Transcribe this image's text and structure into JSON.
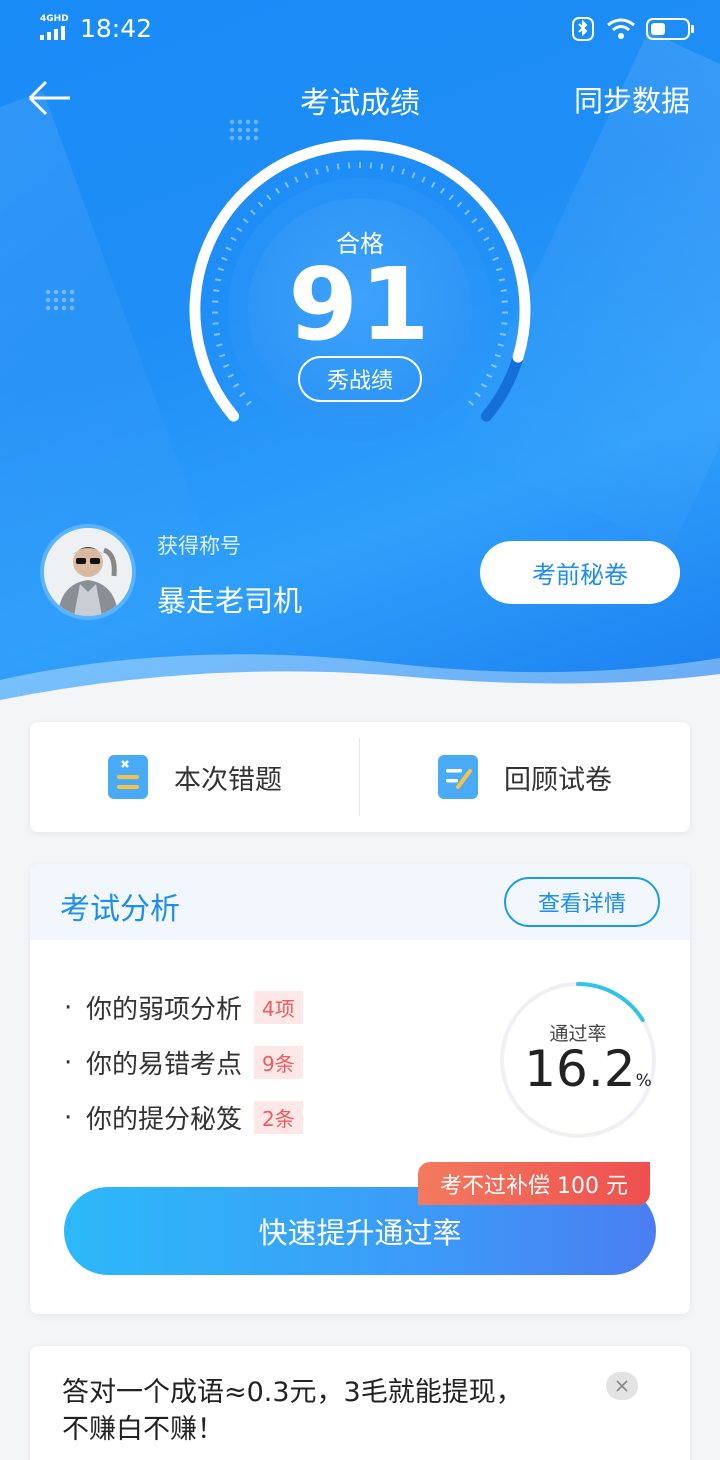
{
  "status": {
    "network": "4GHD",
    "time": "18:42"
  },
  "header": {
    "title": "考试成绩",
    "sync_label": "同步数据"
  },
  "score": {
    "result": "合格",
    "value": "91",
    "share_label": "秀战绩"
  },
  "profile": {
    "honor_label": "获得称号",
    "honor_value": "暴走老司机",
    "secret_button": "考前秘卷"
  },
  "actions": {
    "wrong_label": "本次错题",
    "review_label": "回顾试卷"
  },
  "analysis": {
    "title": "考试分析",
    "detail_button": "查看详情",
    "items": [
      {
        "label": "你的弱项分析",
        "tag": "4项"
      },
      {
        "label": "你的易错考点",
        "tag": "9条"
      },
      {
        "label": "你的提分秘笈",
        "tag": "2条"
      }
    ],
    "rate_label": "通过率",
    "rate_value": "16.2",
    "rate_unit": "%",
    "promo_badge": "考不过补偿 100 元",
    "boost_button": "快速提升通过率"
  },
  "ad": {
    "text_line1": "答对一个成语≈0.3元，3毛就能提现，",
    "text_line2": "不赚白不赚！"
  },
  "colors": {
    "primary": "#1d8df4",
    "tag_red": "#f15b5b",
    "hero_blue": "#1a8cf7"
  }
}
